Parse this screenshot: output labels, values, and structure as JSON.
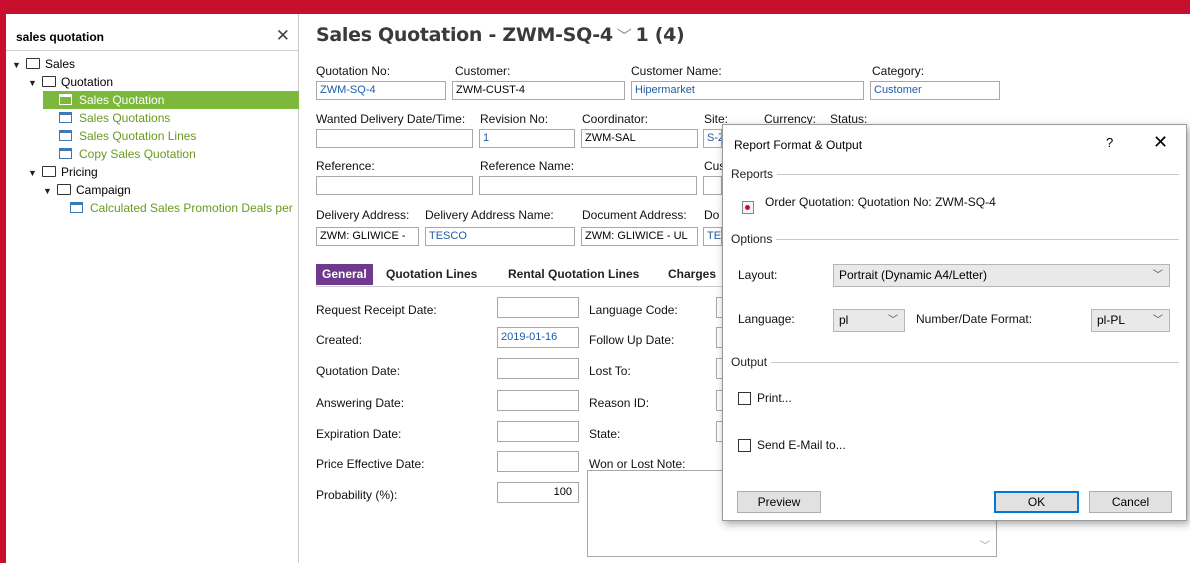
{
  "navigator": {
    "search_text": "sales quotation",
    "close_glyph": "✕",
    "tree": [
      {
        "label": "Sales"
      },
      {
        "label": "Quotation"
      },
      {
        "label": "Sales Quotation"
      },
      {
        "label": "Sales Quotations"
      },
      {
        "label": "Sales Quotation Lines"
      },
      {
        "label": "Copy Sales Quotation"
      },
      {
        "label": "Pricing"
      },
      {
        "label": "Campaign"
      },
      {
        "label": "Calculated Sales Promotion Deals per"
      }
    ]
  },
  "header": {
    "title": "Sales Quotation - ZWM-SQ-4",
    "record_position": "1 (4)"
  },
  "form": {
    "quotation_no_label": "Quotation No:",
    "quotation_no": "ZWM-SQ-4",
    "customer_label": "Customer:",
    "customer": "ZWM-CUST-4",
    "customer_name_label": "Customer Name:",
    "customer_name": "Hipermarket",
    "category_label": "Category:",
    "category": "Customer",
    "wanted_delivery_label": "Wanted Delivery Date/Time:",
    "wanted_delivery": "",
    "revision_no_label": "Revision No:",
    "revision_no": "1",
    "coordinator_label": "Coordinator:",
    "coordinator": "ZWM-SAL",
    "site_label": "Site:",
    "site": "S-Z",
    "currency_label": "Currency:",
    "status_label": "Status:",
    "reference_label": "Reference:",
    "reference": "",
    "reference_name_label": "Reference Name:",
    "reference_name": "",
    "cust_label_partial": "Cus",
    "delivery_address_label": "Delivery Address:",
    "delivery_address": "ZWM: GLIWICE -",
    "delivery_address_name_label": "Delivery Address Name:",
    "delivery_address_name": "TESCO",
    "document_address_label": "Document Address:",
    "document_address": "ZWM: GLIWICE - UL",
    "doc_label_partial": "Do",
    "doc_value_partial": "TE"
  },
  "tabs": [
    "General",
    "Quotation Lines",
    "Rental Quotation Lines",
    "Charges"
  ],
  "general": {
    "request_receipt_date_label": "Request Receipt Date:",
    "request_receipt_date": "",
    "created_label": "Created:",
    "created": "2019-01-16",
    "quotation_date_label": "Quotation Date:",
    "quotation_date": "",
    "answering_date_label": "Answering Date:",
    "answering_date": "",
    "expiration_date_label": "Expiration Date:",
    "expiration_date": "",
    "price_effective_date_label": "Price Effective Date:",
    "price_effective_date": "",
    "probability_label": "Probability (%):",
    "probability": "100",
    "language_code_label": "Language Code:",
    "follow_up_date_label": "Follow Up Date:",
    "lost_to_label": "Lost To:",
    "reason_id_label": "Reason ID:",
    "state_label": "State:",
    "won_lost_note_label": "Won or Lost Note:"
  },
  "dialog": {
    "title": "Report Format & Output",
    "help": "?",
    "close": "✕",
    "reports_group": "Reports",
    "report_item": "Order Quotation: Quotation No: ZWM-SQ-4",
    "options_group": "Options",
    "layout_label": "Layout:",
    "layout_value": "Portrait (Dynamic A4/Letter)",
    "language_label": "Language:",
    "language_value": "pl",
    "number_format_label": "Number/Date Format:",
    "number_format_value": "pl-PL",
    "output_group": "Output",
    "print_label": "Print...",
    "email_label": "Send E-Mail to...",
    "preview_button": "Preview",
    "ok_button": "OK",
    "cancel_button": "Cancel"
  },
  "colors": {
    "frame": "#c8102e",
    "tree_selected": "#7cb83c",
    "tab_active": "#6f3a8e",
    "link_blue": "#1f5ca8"
  }
}
